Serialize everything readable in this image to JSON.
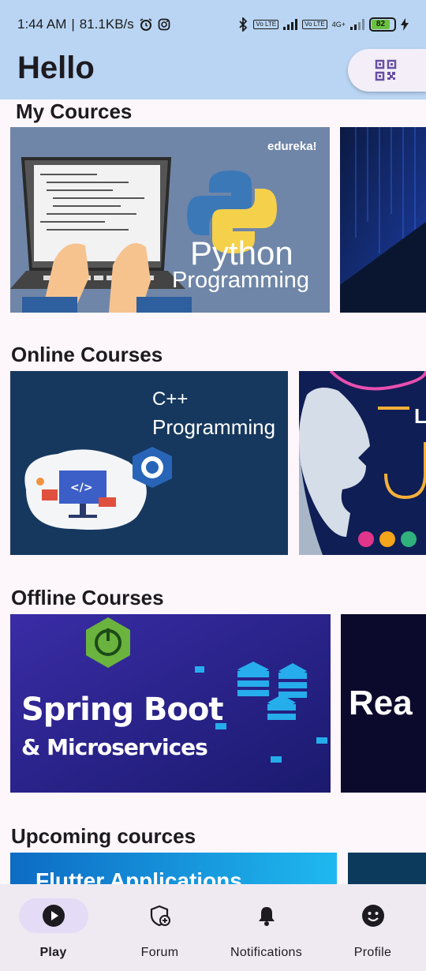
{
  "status": {
    "time": "1:44 AM",
    "speed": "81.1KB/s",
    "volte1": "Vo LTE",
    "volte2": "Vo LTE",
    "network": "4G+",
    "battery": "82"
  },
  "appbar": {
    "title": "Hello",
    "qr_icon": "qr-code-scanner-icon"
  },
  "sections": {
    "my_courses": "My Cources",
    "online_courses": "Online Courses",
    "offline_courses": "Offline Courses",
    "upcoming": "Upcoming cources"
  },
  "cards": {
    "python": {
      "brand": "edureka!",
      "line1": "Python",
      "line2": "Programming"
    },
    "cpp": {
      "line1": "C++",
      "line2": "Programming",
      "logo": "C+"
    },
    "ai": {
      "letter": "L"
    },
    "spring": {
      "line1": "Spring Boot",
      "line2": "& Microservices"
    },
    "react": {
      "text": "Rea"
    },
    "flutter": {
      "text": "Flutter Applications"
    }
  },
  "nav": {
    "items": [
      {
        "label": "Play",
        "icon": "play-icon"
      },
      {
        "label": "Forum",
        "icon": "shield-add-icon"
      },
      {
        "label": "Notifications",
        "icon": "bell-icon"
      },
      {
        "label": "Profile",
        "icon": "smiley-face-icon"
      }
    ]
  },
  "colors": {
    "appbar": "#b9d5f3",
    "nav_bg": "#efe9f2",
    "nav_active": "#e4dbf7",
    "qr_icon": "#6750a4"
  }
}
